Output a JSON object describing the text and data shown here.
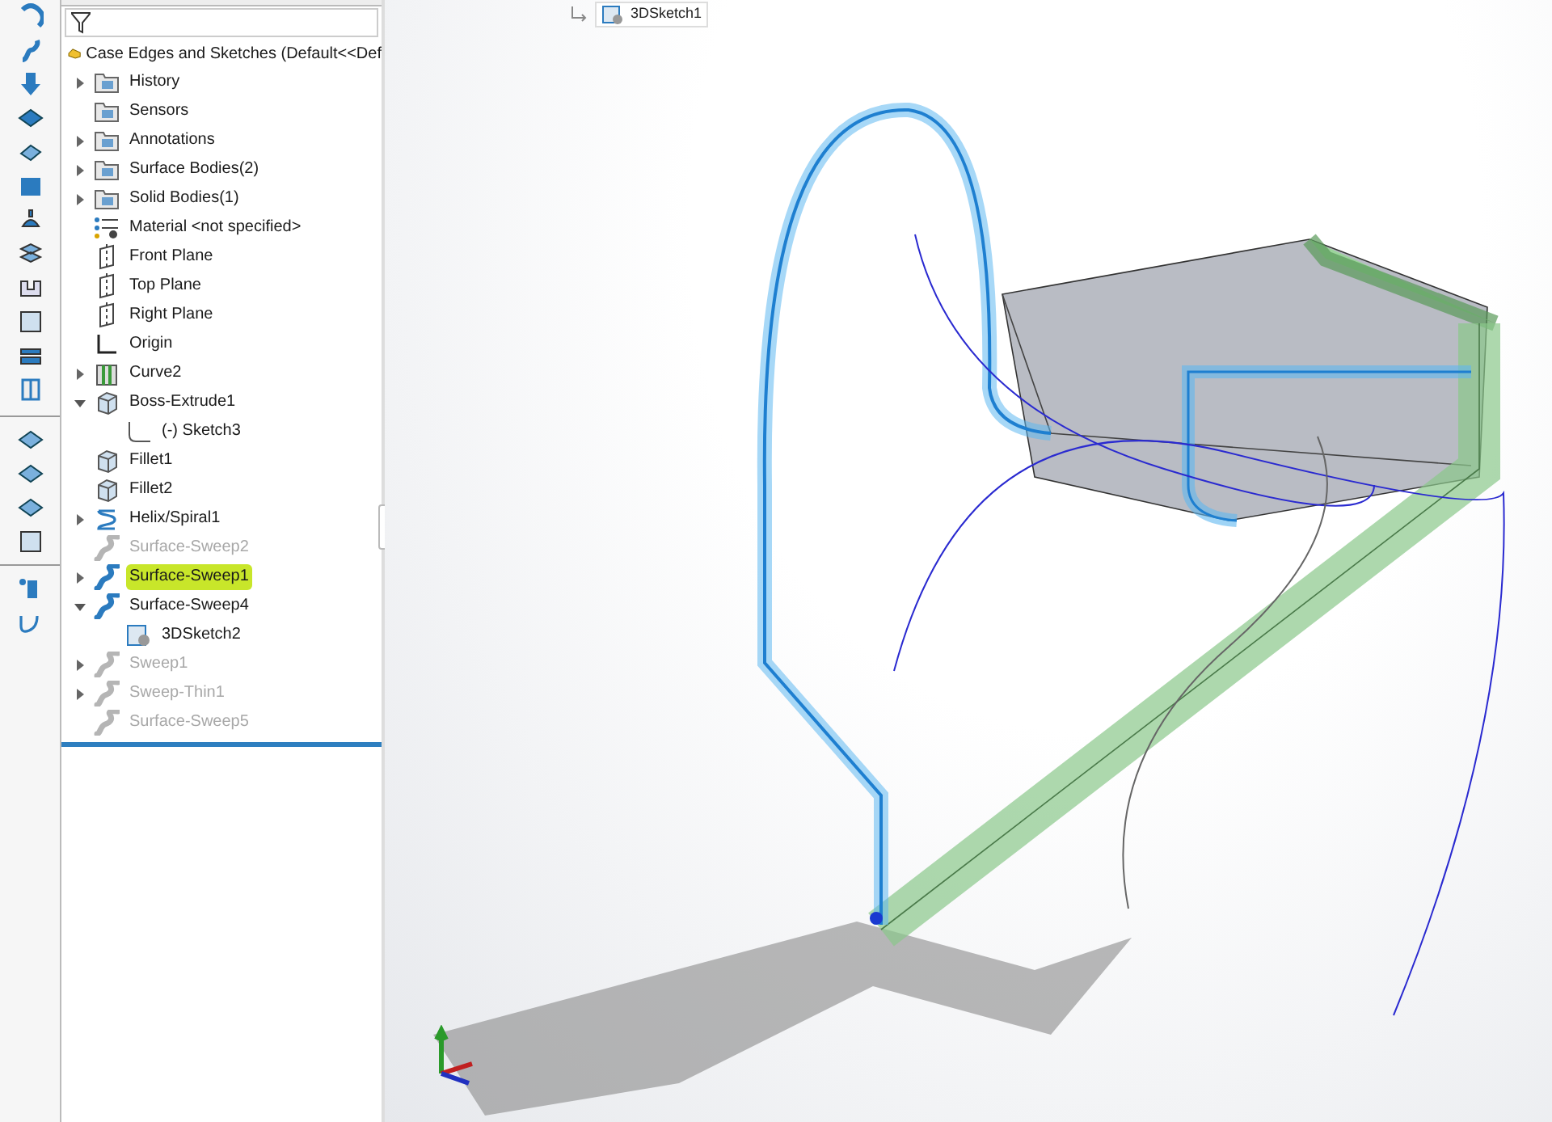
{
  "tree": {
    "title": "Case Edges and Sketches  (Default<<Def",
    "items": [
      {
        "label": "History",
        "kind": "folder",
        "expanded": false,
        "dimmed": false,
        "selected": false
      },
      {
        "label": "Sensors",
        "kind": "folder",
        "dimmed": false,
        "selected": false
      },
      {
        "label": "Annotations",
        "kind": "folder",
        "expanded": false,
        "dimmed": false,
        "selected": false
      },
      {
        "label": "Surface Bodies(2)",
        "kind": "folder",
        "expanded": false,
        "dimmed": false,
        "selected": false
      },
      {
        "label": "Solid Bodies(1)",
        "kind": "folder",
        "expanded": false,
        "dimmed": false,
        "selected": false
      },
      {
        "label": "Material <not specified>",
        "kind": "material",
        "dimmed": false,
        "selected": false
      },
      {
        "label": "Front Plane",
        "kind": "plane",
        "dimmed": false,
        "selected": false
      },
      {
        "label": "Top Plane",
        "kind": "plane",
        "dimmed": false,
        "selected": false
      },
      {
        "label": "Right Plane",
        "kind": "plane",
        "dimmed": false,
        "selected": false
      },
      {
        "label": "Origin",
        "kind": "origin",
        "dimmed": false,
        "selected": false
      },
      {
        "label": "Curve2",
        "kind": "curve",
        "expanded": false,
        "dimmed": false,
        "selected": false
      },
      {
        "label": "Boss-Extrude1",
        "kind": "feature",
        "expanded": true,
        "dimmed": false,
        "selected": false,
        "children": [
          {
            "label": "(-) Sketch3",
            "kind": "sketch",
            "dimmed": false,
            "selected": false
          }
        ]
      },
      {
        "label": "Fillet1",
        "kind": "feature",
        "dimmed": false,
        "selected": false
      },
      {
        "label": "Fillet2",
        "kind": "feature",
        "dimmed": false,
        "selected": false
      },
      {
        "label": "Helix/Spiral1",
        "kind": "helix",
        "expanded": false,
        "dimmed": false,
        "selected": false
      },
      {
        "label": "Surface-Sweep2",
        "kind": "sweep",
        "dimmed": true,
        "selected": false
      },
      {
        "label": "Surface-Sweep1",
        "kind": "sweep",
        "expanded": false,
        "dimmed": false,
        "selected": true
      },
      {
        "label": "Surface-Sweep4",
        "kind": "sweep",
        "expanded": true,
        "dimmed": false,
        "selected": false,
        "children": [
          {
            "label": "3DSketch2",
            "kind": "sketch3d",
            "dimmed": false,
            "selected": false
          }
        ]
      },
      {
        "label": "Sweep1",
        "kind": "sweep",
        "expanded": false,
        "dimmed": true,
        "selected": false
      },
      {
        "label": "Sweep-Thin1",
        "kind": "sweep",
        "expanded": false,
        "dimmed": true,
        "selected": false
      },
      {
        "label": "Surface-Sweep5",
        "kind": "sweep",
        "dimmed": true,
        "selected": false
      }
    ]
  },
  "viewport": {
    "breadcrumb": "3DSketch1"
  }
}
